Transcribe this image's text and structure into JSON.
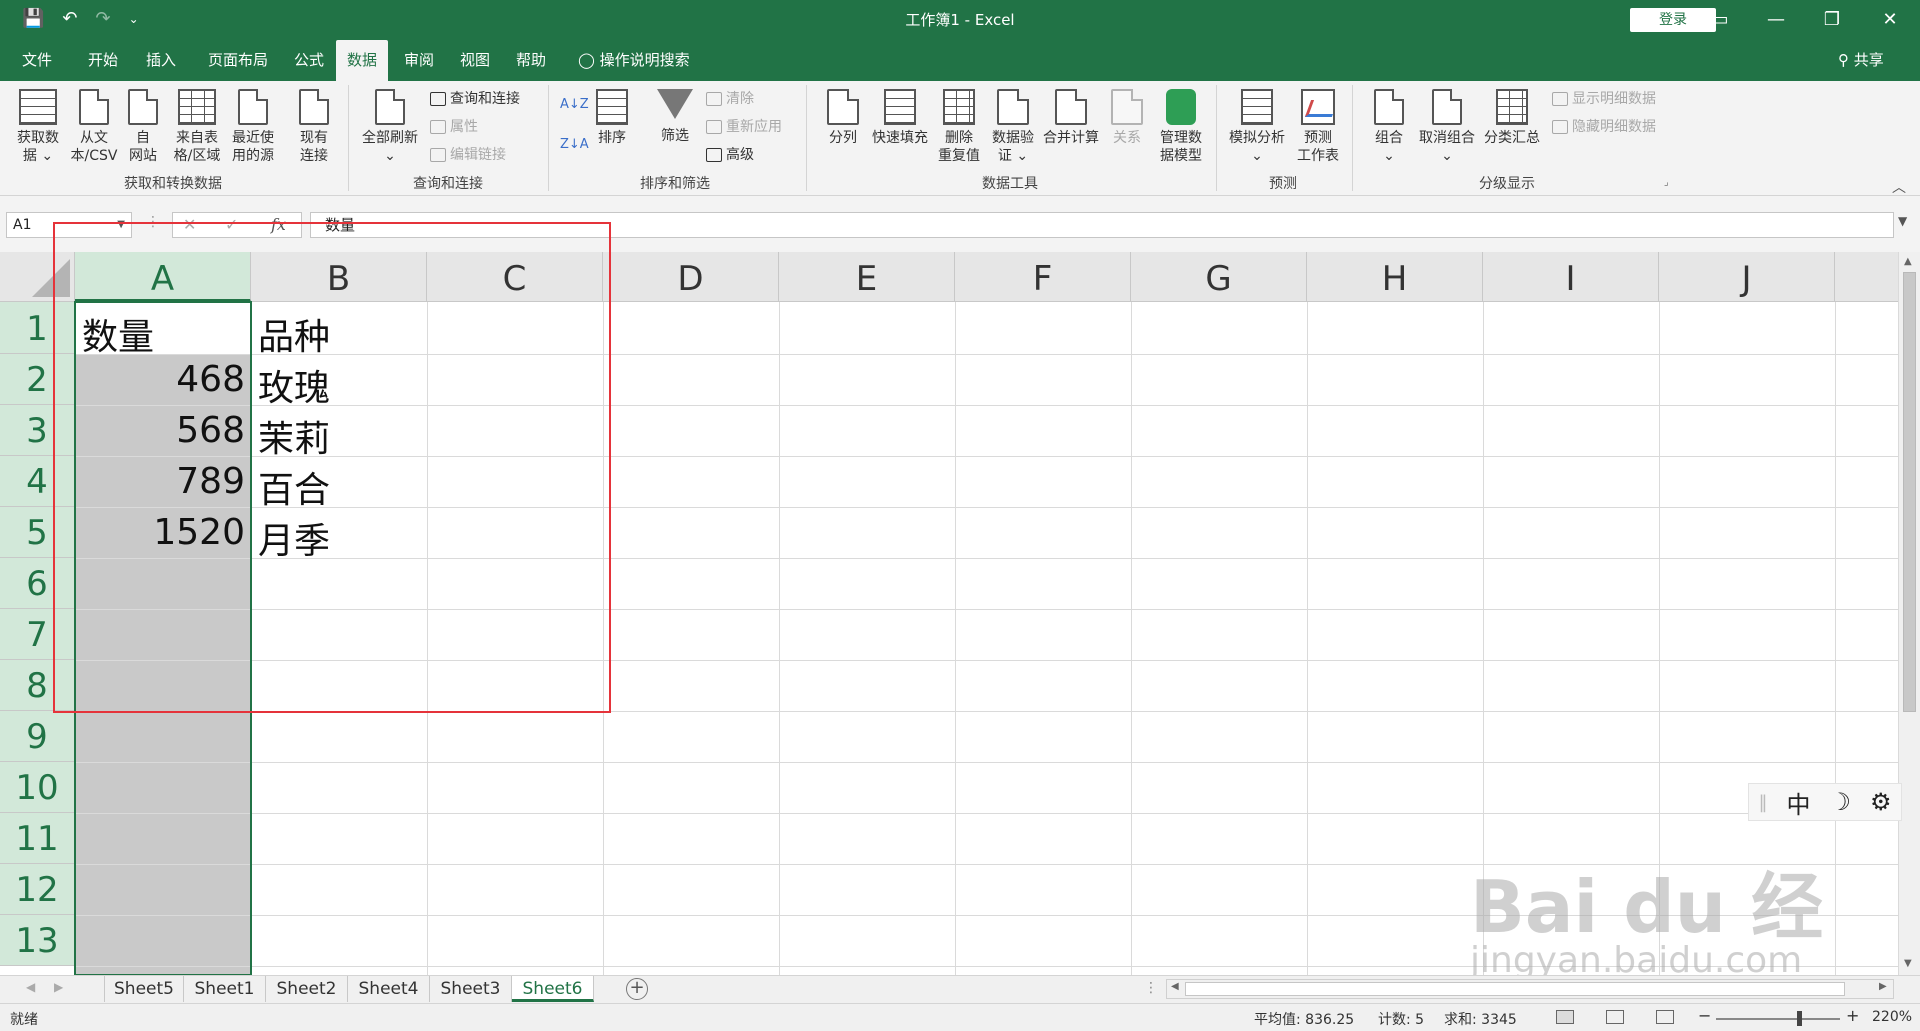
{
  "window": {
    "title": "工作簿1  -  Excel",
    "login_label": "登录",
    "qat": {
      "save": "💾",
      "undo": "↶",
      "redo": "↷",
      "customize": "⌄"
    },
    "controls": {
      "ribbon_options": "▭",
      "minimize": "—",
      "restore": "❐",
      "close": "✕"
    }
  },
  "menu": {
    "tabs": [
      "文件",
      "开始",
      "插入",
      "页面布局",
      "公式",
      "数据",
      "审阅",
      "视图",
      "帮助"
    ],
    "active_tab": "数据",
    "tell_me": "操作说明搜索",
    "share": "共享"
  },
  "ribbon": {
    "get_transform": {
      "label": "获取和转换数据",
      "buttons": [
        "获取数\n据 ⌄",
        "从文\n本/CSV",
        "自\n网站",
        "来自表\n格/区域",
        "最近使\n用的源",
        "现有\n连接"
      ]
    },
    "queries": {
      "label": "查询和连接",
      "refresh_all": "全部刷新\n⌄",
      "queries_connections": "查询和连接",
      "properties": "属性",
      "edit_links": "编辑链接"
    },
    "sort_filter": {
      "label": "排序和筛选",
      "sort_az": "A↓Z",
      "sort_za": "Z↓A",
      "sort": "排序",
      "filter": "筛选",
      "clear": "清除",
      "reapply": "重新应用",
      "advanced": "高级"
    },
    "data_tools": {
      "label": "数据工具",
      "buttons": [
        "分列",
        "快速填充",
        "删除\n重复值",
        "数据验\n证 ⌄",
        "合并计算",
        "关系",
        "管理数\n据模型"
      ]
    },
    "forecast": {
      "label": "预测",
      "buttons": [
        "模拟分析\n⌄",
        "预测\n工作表"
      ]
    },
    "outline": {
      "label": "分级显示",
      "buttons": [
        "组合\n⌄",
        "取消组合\n⌄",
        "分类汇总"
      ],
      "show_detail": "显示明细数据",
      "hide_detail": "隐藏明细数据"
    }
  },
  "formula_bar": {
    "name_box": "A1",
    "content": "数量",
    "fx": "fx",
    "cancel": "✕",
    "enter": "✓"
  },
  "sheet": {
    "columns": [
      "A",
      "B",
      "C",
      "D",
      "E",
      "F",
      "G",
      "H",
      "I",
      "J"
    ],
    "rows": [
      "1",
      "2",
      "3",
      "4",
      "5",
      "6",
      "7",
      "8",
      "9",
      "10",
      "11",
      "12",
      "13"
    ],
    "cells": {
      "A1": "数量",
      "B1": "品种",
      "A2": "468",
      "B2": "玫瑰",
      "A3": "568",
      "B3": "茉莉",
      "A4": "789",
      "B4": "百合",
      "A5": "1520",
      "B5": "月季"
    }
  },
  "ime": {
    "mode": "中",
    "moon": "☽",
    "settings": "⚙"
  },
  "watermark": {
    "main": "Bai du 经验",
    "sub": "jingyan.baidu.com"
  },
  "sheet_tabs": {
    "tabs": [
      "Sheet5",
      "Sheet1",
      "Sheet2",
      "Sheet4",
      "Sheet3",
      "Sheet6"
    ],
    "active": "Sheet6"
  },
  "status": {
    "ready": "就绪",
    "average": "平均值: 836.25",
    "count": "计数: 5",
    "sum": "求和: 3345",
    "zoom": "220%"
  }
}
